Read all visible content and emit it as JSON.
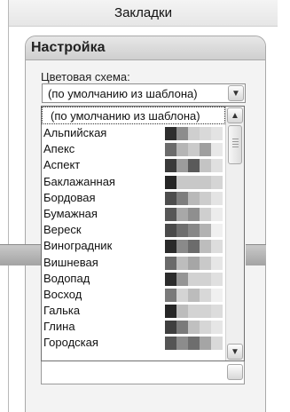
{
  "header": {
    "title": "Закладки"
  },
  "settings": {
    "title": "Настройка",
    "color_scheme_label": "Цветовая схема:",
    "selected_value": "(по умолчанию из шаблона)"
  },
  "dropdown": {
    "first_option": "(по умолчанию из шаблона)",
    "items": [
      {
        "name": "Альпийская",
        "swatches": [
          "#2e2e2e",
          "#8d8d8d",
          "#cfcfcf",
          "#d9d9d9",
          "#e3e3e3"
        ]
      },
      {
        "name": "Апекс",
        "swatches": [
          "#6b6b6b",
          "#b5b5b5",
          "#cacaca",
          "#9f9f9f",
          "#e8e8e8"
        ]
      },
      {
        "name": "Аспект",
        "swatches": [
          "#3a3a3a",
          "#9c9c9c",
          "#5a5a5a",
          "#c4c4c4",
          "#e0e0e0"
        ]
      },
      {
        "name": "Баклажанная",
        "swatches": [
          "#262626",
          "#c8c8c8",
          "#c8c8c8",
          "#c8c8c8",
          "#d5d5d5"
        ]
      },
      {
        "name": "Бордовая",
        "swatches": [
          "#4d4d4d",
          "#7e7e7e",
          "#b9b9b9",
          "#cdcdcd",
          "#e4e4e4"
        ]
      },
      {
        "name": "Бумажная",
        "swatches": [
          "#575757",
          "#a8a8a8",
          "#8f8f8f",
          "#cfcfcf",
          "#ececec"
        ]
      },
      {
        "name": "Вереск",
        "swatches": [
          "#4a4a4a",
          "#6e6e6e",
          "#878787",
          "#b2b2b2",
          "#f0f0f0"
        ]
      },
      {
        "name": "Виноградник",
        "swatches": [
          "#2a2a2a",
          "#8a8a8a",
          "#6c6c6c",
          "#bdbdbd",
          "#dddddd"
        ]
      },
      {
        "name": "Вишневая",
        "swatches": [
          "#6a6a6a",
          "#bdbdbd",
          "#a6a6a6",
          "#c9c9c9",
          "#e6e6e6"
        ]
      },
      {
        "name": "Водопад",
        "swatches": [
          "#2c2c2c",
          "#959595",
          "#d2d2d2",
          "#d2d2d2",
          "#e0e0e0"
        ]
      },
      {
        "name": "Восход",
        "swatches": [
          "#7a7a7a",
          "#d4d4d4",
          "#bcbcbc",
          "#d8d8d8",
          "#f0f0f0"
        ]
      },
      {
        "name": "Галька",
        "swatches": [
          "#262626",
          "#bcbcbc",
          "#d3d3d3",
          "#d3d3d3",
          "#dcdcdc"
        ]
      },
      {
        "name": "Глина",
        "swatches": [
          "#3f3f3f",
          "#7a7a7a",
          "#c0c0c0",
          "#d6d6d6",
          "#e6e6e6"
        ]
      },
      {
        "name": "Городская",
        "swatches": [
          "#555555",
          "#8c8c8c",
          "#6e6e6e",
          "#a5a5a5",
          "#d9d9d9"
        ]
      }
    ]
  },
  "icons": {
    "select_arrow": "chevron-down-icon",
    "scroll_up": "chevron-up-icon",
    "scroll_down": "chevron-down-icon"
  }
}
